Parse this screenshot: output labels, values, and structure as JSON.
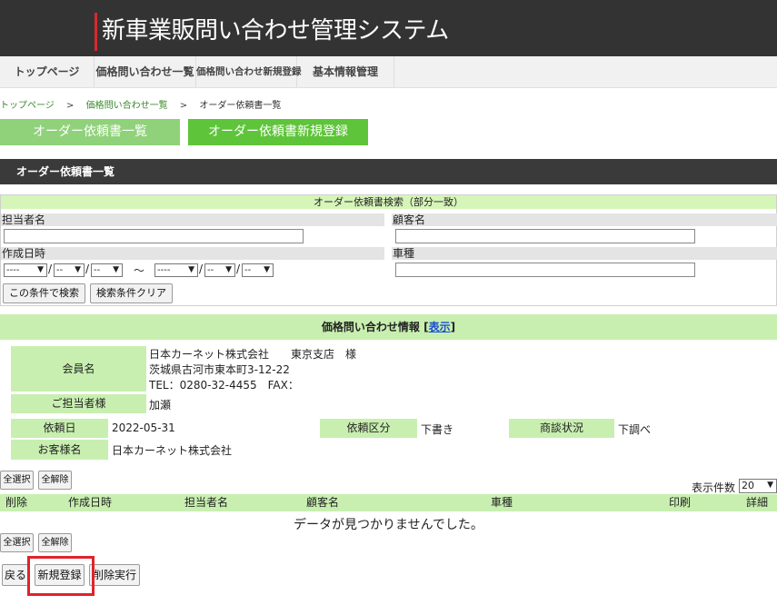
{
  "app": {
    "title": "新車業販問い合わせ管理システム"
  },
  "nav": [
    "トップページ",
    "価格問い合わせ一覧",
    "価格問い合わせ新規登録",
    "基本情報管理"
  ],
  "breadcrumb": {
    "items": [
      "トップページ",
      "価格問い合わせ一覧"
    ],
    "separator": ">",
    "current": "オーダー依頼書一覧"
  },
  "tabs": {
    "list": "オーダー依頼書一覧",
    "new": "オーダー依頼書新規登録"
  },
  "section_title": "オーダー依頼書一覧",
  "search": {
    "title": "オーダー依頼書検索（部分一致）",
    "tanto_label": "担当者名",
    "tanto_value": "",
    "kokyaku_label": "顧客名",
    "kokyaku_value": "",
    "sakusei_label": "作成日時",
    "shashu_label": "車種",
    "shashu_value": "",
    "date_from": {
      "year": "----",
      "month": "--",
      "day": "--"
    },
    "date_to": {
      "year": "----",
      "month": "--",
      "day": "--"
    },
    "tilde": "～",
    "search_button": "この条件で検索",
    "clear_button": "検索条件クリア"
  },
  "inquiry": {
    "title": "価格問い合わせ情報",
    "show_link": "表示",
    "member_label": "会員名",
    "member_line1": "日本カーネット株式会社　　東京支店　様",
    "member_line2": "茨城県古河市東本町3-12-22",
    "member_line3": "TEL：0280-32-4455　FAX：",
    "contact_label": "ご担当者様",
    "contact_value": "加瀬",
    "request_date_label": "依頼日",
    "request_date_value": "2022-05-31",
    "request_type_label": "依頼区分",
    "request_type_value": "下書き",
    "deal_status_label": "商談状況",
    "deal_status_value": "下調べ",
    "customer_label": "お客様名",
    "customer_value": "日本カーネット株式会社"
  },
  "list": {
    "select_all": "全選択",
    "deselect_all": "全解除",
    "per_page_label": "表示件数",
    "per_page_value": "20",
    "columns": [
      "削除",
      "作成日時",
      "担当者名",
      "顧客名",
      "車種",
      "印刷",
      "詳細"
    ],
    "empty_message": "データが見つかりませんでした。"
  },
  "footer": {
    "back": "戻る",
    "new": "新規登録",
    "delete": "削除実行"
  },
  "colors": {
    "accent_red": "#d9282f",
    "green_light": "#c8efb0",
    "green_tab": "#8fd27a",
    "green_tab_active": "#5ec43a",
    "dark_header": "#333333"
  }
}
